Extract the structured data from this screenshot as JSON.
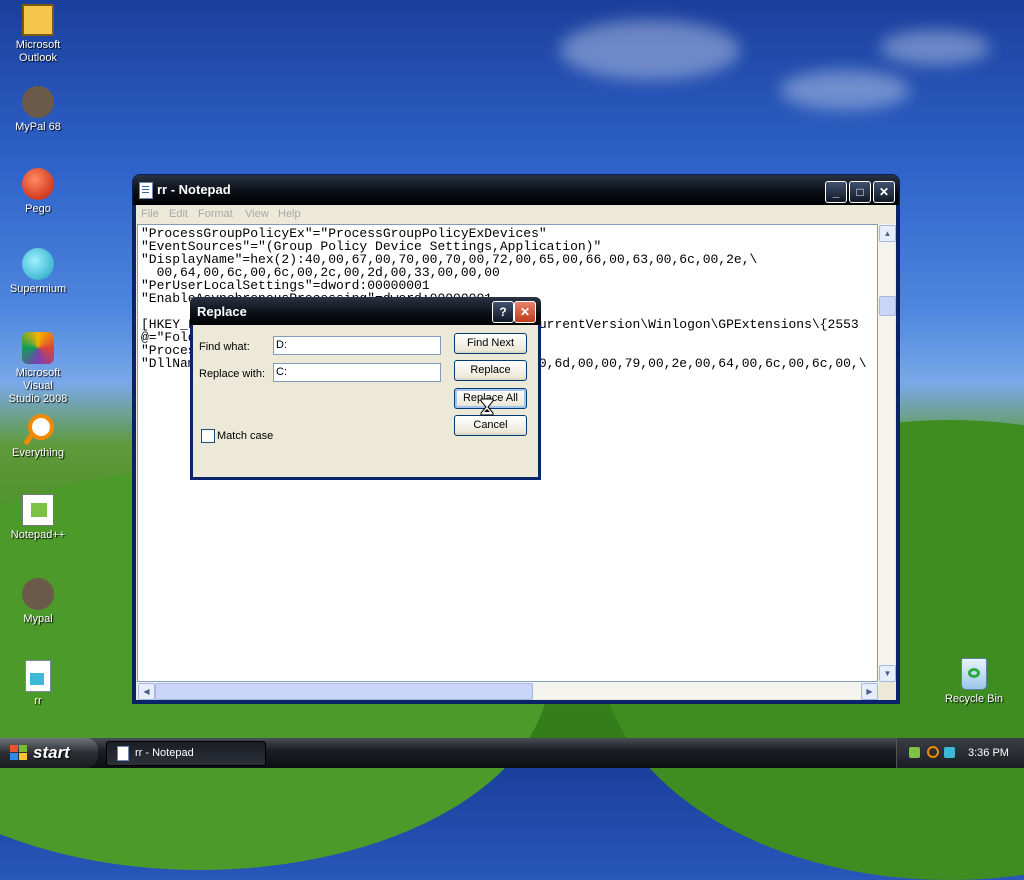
{
  "desktop": {
    "icons": [
      {
        "label": "Microsoft Outlook",
        "line1": "Microsoft",
        "line2": "Outlook"
      },
      {
        "label": "MyPal 68",
        "line1": "MyPal 68",
        "line2": ""
      },
      {
        "label": "Pego",
        "line1": "Pego",
        "line2": ""
      },
      {
        "label": "Supermium",
        "line1": "Supermium",
        "line2": ""
      },
      {
        "label": "Microsoft Visual Studio 2008",
        "line1": "Microsoft Visual",
        "line2": "Studio 2008"
      },
      {
        "label": "Everything",
        "line1": "Everything",
        "line2": ""
      },
      {
        "label": "Notepad++",
        "line1": "Notepad++",
        "line2": ""
      },
      {
        "label": "Mypal",
        "line1": "Mypal",
        "line2": ""
      },
      {
        "label": "rr",
        "line1": "rr",
        "line2": ""
      },
      {
        "label": "Recycle Bin",
        "line1": "Recycle Bin",
        "line2": ""
      }
    ]
  },
  "notepad": {
    "title": "rr - Notepad",
    "menu": [
      "File",
      "Edit",
      "Format",
      "View",
      "Help"
    ],
    "minimize_glyph": "_",
    "maximize_glyph": "□",
    "close_glyph": "✕",
    "content": "\"ProcessGroupPolicyEx\"=\"ProcessGroupPolicyExDevices\"\n\"EventSources\"=\"(Group Policy Device Settings,Application)\"\n\"DisplayName\"=hex(2):40,00,67,00,70,00,70,00,72,00,65,00,66,00,63,00,6c,00,2e,\\\n  00,64,00,6c,00,6c,00,2c,00,2d,00,33,00,00,00\n\"PerUserLocalSettings\"=dword:00000001\n\"EnableAsynchronousProcessing\"=dword:00000001\n\n[HKEY_LOCAL_MACHINE\\SOFTWARE\\Microsoft\\Windows NT\\CurrentVersion\\Winlogon\\GPExtensions\\{2553\n@=\"Folder Redirection\"\n\"ProcessGroupPolicy\"=\"ProcessGroupPolicy\"\n\"DllName\"=hex(2):25,00,73,00,79,00,73,00,74,00,65,00,6d,00,00,79,00,2e,00,64,00,6c,00,6c,00,\\"
  },
  "replace_dialog": {
    "title": "Replace",
    "help_glyph": "?",
    "close_glyph": "✕",
    "find_label": "Find what:",
    "find_value": "D:",
    "replace_label": "Replace with:",
    "replace_value": "C:",
    "match_case_label": "Match case",
    "match_case_checked": false,
    "buttons": {
      "find_next": "Find Next",
      "replace": "Replace",
      "replace_all": "Replace All",
      "cancel": "Cancel"
    }
  },
  "taskbar": {
    "start_label": "start",
    "window_button_label": "rr - Notepad",
    "clock": "3:36 PM"
  }
}
